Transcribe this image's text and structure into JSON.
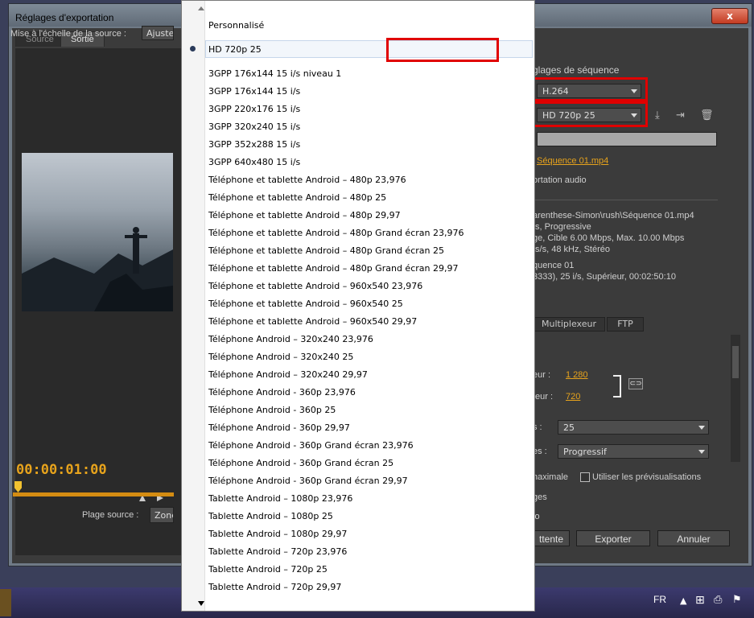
{
  "window": {
    "title": "Réglages d'exportation",
    "close_label": "x"
  },
  "tabs": {
    "source": "Source",
    "output": "Sortie"
  },
  "left": {
    "scale_label": "Mise à l'échelle de la source :",
    "scale_value": "Ajuste",
    "timecode": "00:00:01:00",
    "range_label": "Plage source :",
    "range_value": "Zone"
  },
  "right": {
    "seq_heading": "glages de séquence",
    "format_value": "H.264",
    "preset_value": "HD 720p 25",
    "output_file": "Séquence 01.mp4",
    "audio_export": "ortation audio",
    "summary": [
      "arenthese-Simon\\rush\\Séquence 01.mp4",
      "/s, Progressive",
      "ge, Cible 6.00 Mbps, Max. 10.00 Mbps",
      "ts/s, 48  kHz, Stéréo"
    ],
    "source_summary": [
      "quence 01",
      "3333), 25  i/s, Supérieur, 00:02:50:10"
    ],
    "tabs": [
      "Multiplexeur",
      "FTP"
    ],
    "width_label": "eur :",
    "width_value": "1 280",
    "height_label": "teur :",
    "height_value": "720",
    "fps_label": "s :",
    "fps_value": "25",
    "field_label": "es :",
    "field_value": "Progressif",
    "max_quality": "naximale",
    "use_previews": "Utiliser les prévisualisations",
    "images": "ges",
    "audio": "lo",
    "queue_button": "ttente",
    "export_button": "Exporter",
    "cancel_button": "Annuler"
  },
  "dropdown": {
    "items": [
      "Personnalisé",
      "HD 720p 25",
      "3GPP 176x144 15 i/s niveau 1",
      "3GPP 176x144 15 i/s",
      "3GPP 220x176 15 i/s",
      "3GPP 320x240 15 i/s",
      "3GPP 352x288 15 i/s",
      "3GPP 640x480 15 i/s",
      "Téléphone et tablette Android – 480p 23,976",
      "Téléphone et tablette Android – 480p 25",
      "Téléphone et tablette Android – 480p 29,97",
      "Téléphone et tablette Android – 480p Grand écran 23,976",
      "Téléphone et tablette Android – 480p Grand écran 25",
      "Téléphone et tablette Android – 480p Grand écran 29,97",
      "Téléphone et tablette Android – 960x540 23,976",
      "Téléphone et tablette Android – 960x540 25",
      "Téléphone et tablette Android – 960x540 29,97",
      "Téléphone Android – 320x240 23,976",
      "Téléphone Android – 320x240 25",
      "Téléphone Android – 320x240 29,97",
      "Téléphone Android - 360p 23,976",
      "Téléphone Android - 360p 25",
      "Téléphone Android - 360p 29,97",
      "Téléphone Android - 360p Grand écran 23,976",
      "Téléphone Android - 360p Grand écran 25",
      "Téléphone Android - 360p Grand écran 29,97",
      "Tablette Android – 1080p 23,976",
      "Tablette Android – 1080p 25",
      "Tablette Android – 1080p 29,97",
      "Tablette Android – 720p 23,976",
      "Tablette Android – 720p 25",
      "Tablette Android – 720p 29,97"
    ],
    "selected_index": 1
  },
  "taskbar": {
    "language": "FR"
  },
  "colors": {
    "accent": "#e7a31c",
    "highlight": "#e00000",
    "panel": "#3b3b3b"
  }
}
